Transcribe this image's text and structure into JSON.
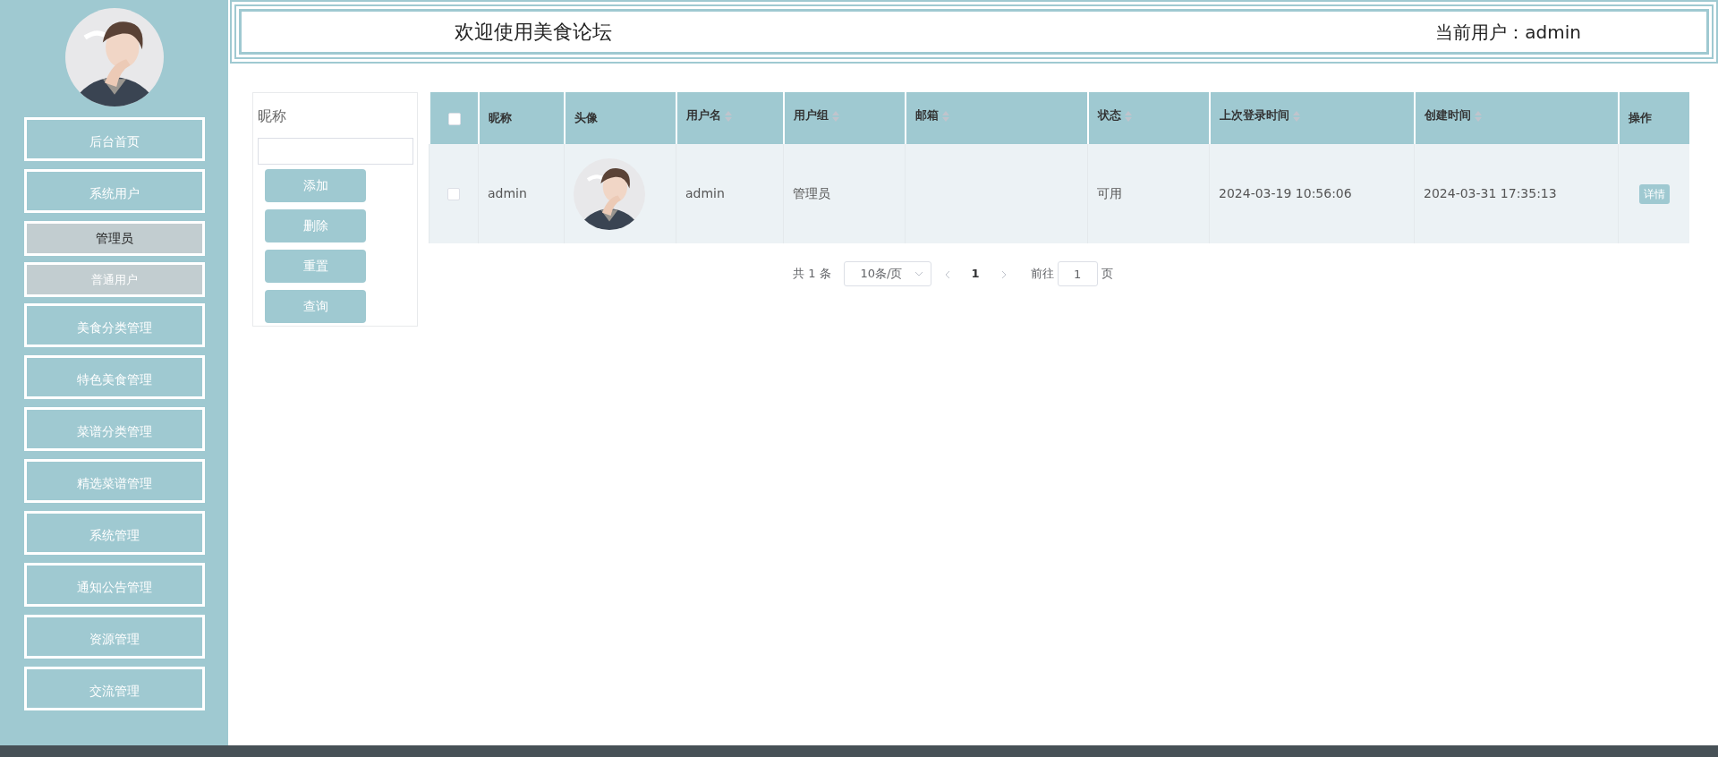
{
  "sidebar": {
    "items": [
      {
        "label": "后台首页",
        "selected": false
      },
      {
        "label": "系统用户",
        "selected": false,
        "expanded": true,
        "children": [
          {
            "label": "管理员",
            "selected": true
          },
          {
            "label": "普通用户",
            "selected": false
          }
        ]
      },
      {
        "label": "美食分类管理",
        "selected": false
      },
      {
        "label": "特色美食管理",
        "selected": false
      },
      {
        "label": "菜谱分类管理",
        "selected": false
      },
      {
        "label": "精选菜谱管理",
        "selected": false
      },
      {
        "label": "系统管理",
        "selected": false
      },
      {
        "label": "通知公告管理",
        "selected": false
      },
      {
        "label": "资源管理",
        "selected": false
      },
      {
        "label": "交流管理",
        "selected": false
      }
    ]
  },
  "header": {
    "title": "欢迎使用美食论坛",
    "current_user": "当前用户：admin"
  },
  "search": {
    "label": "昵称",
    "buttons": [
      "添加",
      "删除",
      "重置",
      "查询"
    ]
  },
  "table": {
    "select_all": {
      "checked": false
    },
    "columns": [
      {
        "label": "昵称",
        "sortable": false
      },
      {
        "label": "头像",
        "sortable": false
      },
      {
        "label": "用户名",
        "sortable": true
      },
      {
        "label": "用户组",
        "sortable": true
      },
      {
        "label": "邮箱",
        "sortable": true
      },
      {
        "label": "状态",
        "sortable": true
      },
      {
        "label": "上次登录时间",
        "sortable": true
      },
      {
        "label": "创建时间",
        "sortable": true
      },
      {
        "label": "操作",
        "sortable": false
      }
    ],
    "rows": [
      {
        "checked": false,
        "nickname": "admin",
        "username": "admin",
        "group": "管理员",
        "status": "可用",
        "last_login": "2024-03-19 10:56:06",
        "created": "2024-03-31 17:35:13",
        "action": "详情"
      }
    ]
  },
  "pagination": {
    "total": "共 1 条",
    "page_size": "10条/页",
    "pages": [
      {
        "label": "1",
        "selected": true
      }
    ],
    "goto_label": "前往",
    "goto_value": "1",
    "goto_suffix": "页"
  }
}
